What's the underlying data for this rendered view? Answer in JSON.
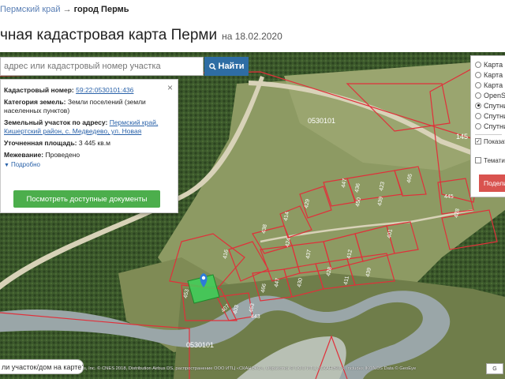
{
  "breadcrumb": {
    "region": "Пермский край",
    "arrow": "→",
    "city": "город Пермь"
  },
  "title": {
    "text": "чная кадастровая карта Перми",
    "date": "на 18.02.2020"
  },
  "search": {
    "placeholder": "адрес или кадастровый номер участка",
    "button_label": "Найти"
  },
  "parcel": {
    "cad_label": "Кадастровый номер:",
    "cad_value": "59:22:0530101:436",
    "category_label": "Категория земель:",
    "category_value": "Земли поселений (земли населенных пунктов)",
    "address_label": "Земельный участок по адресу:",
    "address_value": "Пермский край, Кишертский район, с. Медведево, ул. Новая",
    "area_label": "Уточненная площадь:",
    "area_value": "3 445 кв.м",
    "survey_label": "Межевание:",
    "survey_value": "Проведено",
    "more_label": "Подробно",
    "docs_button": "Посмотреть доступные документы"
  },
  "layers": {
    "options": [
      {
        "label": "Карта",
        "selected": false
      },
      {
        "label": "Карта",
        "selected": false
      },
      {
        "label": "Карта",
        "selected": false
      },
      {
        "label": "OpenS",
        "selected": false
      },
      {
        "label": "Спутни",
        "selected": true
      },
      {
        "label": "Спутни",
        "selected": false
      },
      {
        "label": "Спутни",
        "selected": false
      }
    ],
    "show_borders_label": "Показат границ",
    "show_borders_checked": true,
    "thematic_label": "Темати",
    "thematic_checked": false,
    "print_button": "Подели"
  },
  "map": {
    "quarter_labels": [
      "0530101",
      "0530101",
      "145"
    ],
    "parcel_numbers": [
      "416",
      "438",
      "414",
      "429",
      "453",
      "447",
      "436",
      "423",
      "465",
      "450",
      "439",
      "424",
      "437",
      "412",
      "401",
      "411",
      "439",
      "466",
      "463",
      "447",
      "428",
      "430",
      "403",
      "407",
      "443",
      "428",
      "445"
    ],
    "found_prompt": "ли участок/дом на карте?",
    "attribution": "s, Inc. © CNES 2018, Distribution Airbus DS, распространение ООО ИТЦ «СКАНЭКС», Обработка © ООО ИТЦ «СКАНЭКС», Includes IKONOS Data © GeoEye",
    "google_corner": "G"
  },
  "colors": {
    "accent": "#2e6da4",
    "docs_button": "#4cae4c",
    "print_button": "#d9534f",
    "parcel_border": "#e0303a",
    "selected_parcel": "#3fd15a"
  }
}
